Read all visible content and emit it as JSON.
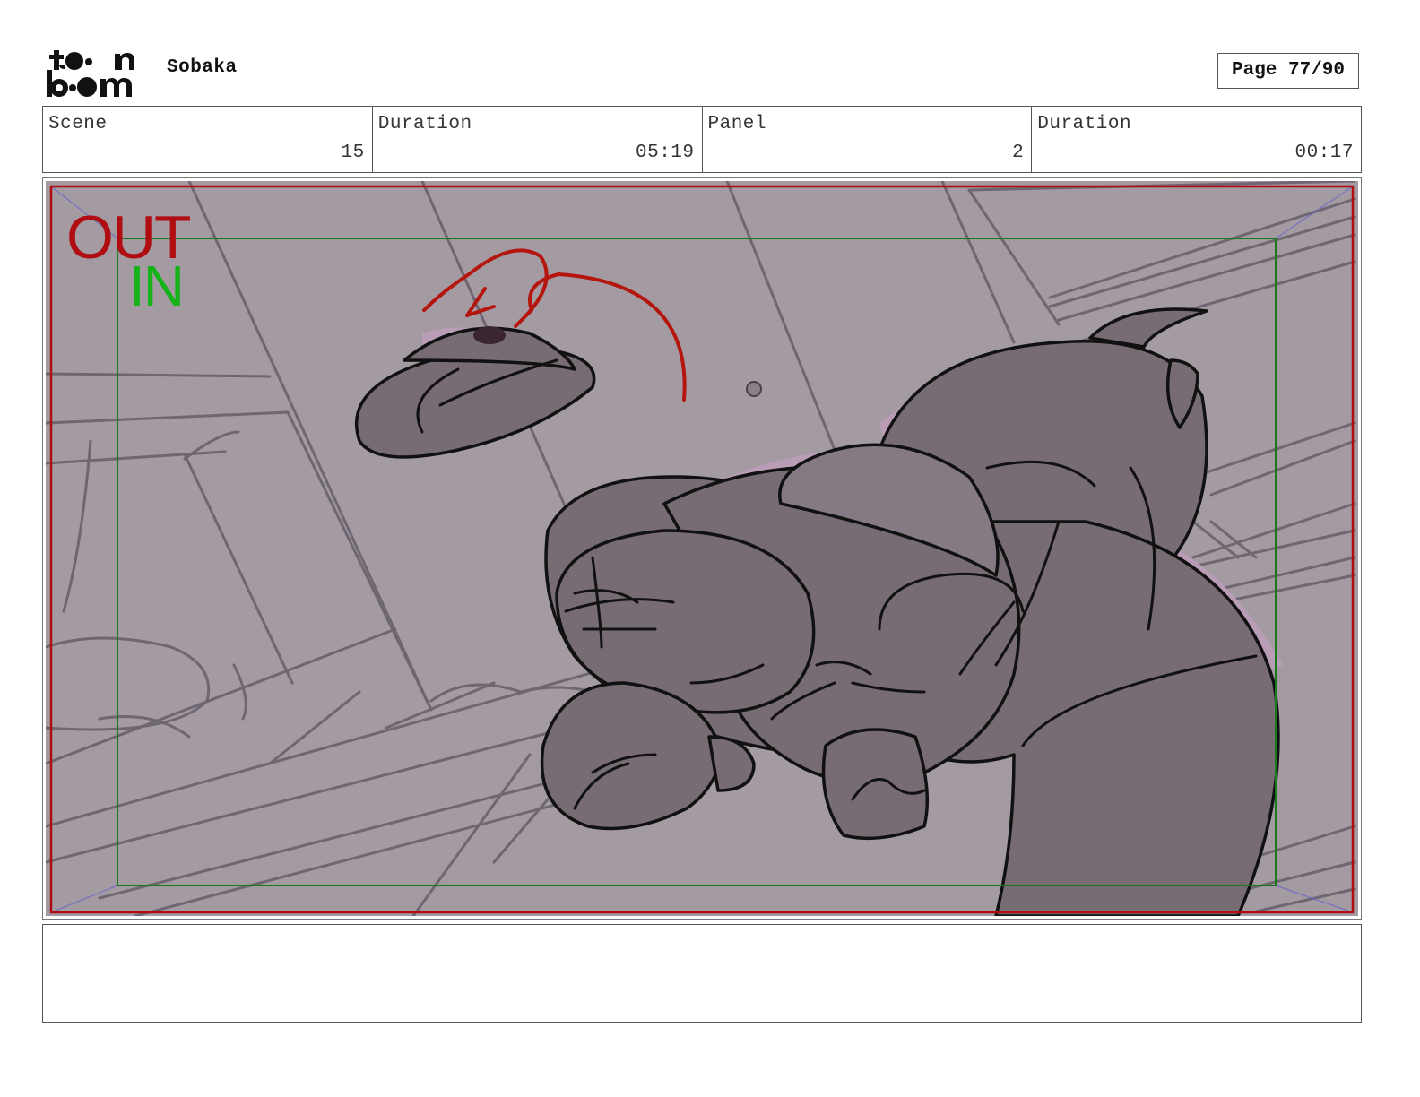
{
  "header": {
    "logo_text": "toon boom",
    "project_title": "Sobaka",
    "page_indicator": "Page 77/90"
  },
  "info_bar": {
    "scene_label": "Scene",
    "scene_value": "15",
    "scene_duration_label": "Duration",
    "scene_duration_value": "05:19",
    "panel_label": "Panel",
    "panel_value": "2",
    "panel_duration_label": "Duration",
    "panel_duration_value": "00:17"
  },
  "panel": {
    "out_label": "OUT",
    "in_label": "IN",
    "colors": {
      "background": "#a39aa2",
      "character_fill": "#776b74",
      "highlight": "#b99cb5",
      "out_frame": "#b00d12",
      "in_frame": "#1a7a1a",
      "arrow": "#b4160e"
    }
  },
  "notes": {
    "text": ""
  }
}
